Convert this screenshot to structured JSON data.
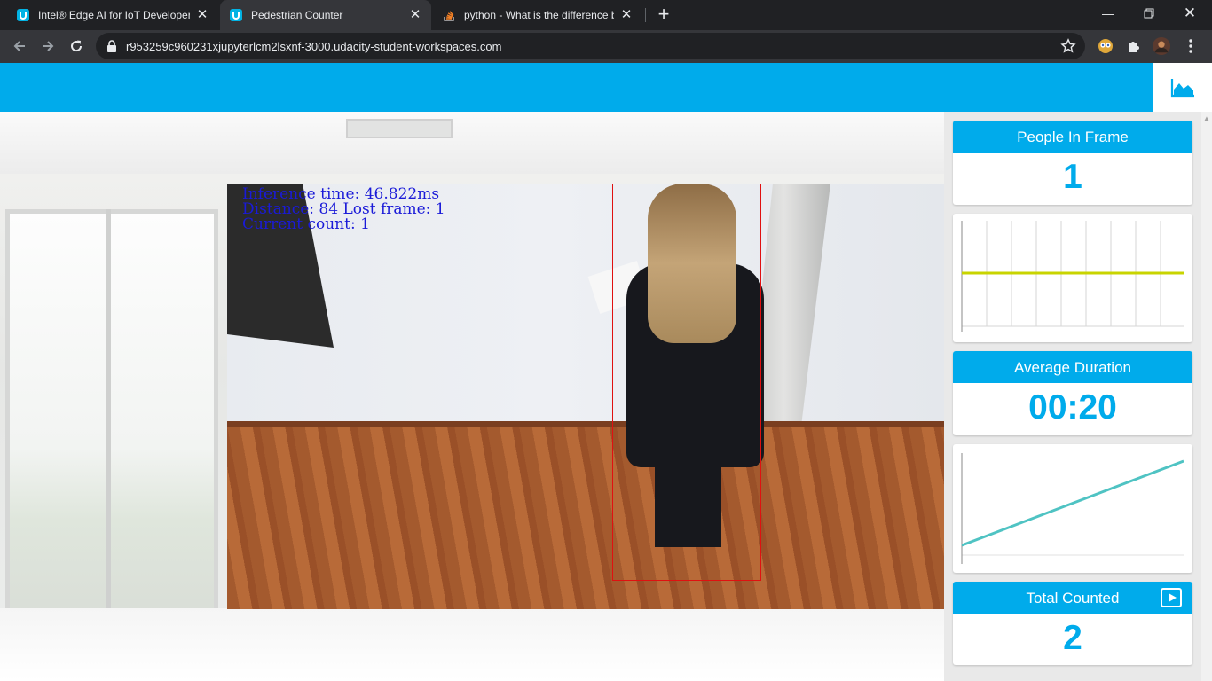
{
  "browser": {
    "tabs": [
      {
        "title": "Intel® Edge AI for IoT Developers",
        "favicon": "udacity-icon",
        "active": false
      },
      {
        "title": "Pedestrian Counter",
        "favicon": "udacity-icon",
        "active": true
      },
      {
        "title": "python - What is the difference b",
        "favicon": "stackoverflow-icon",
        "active": false
      }
    ],
    "url": "r953259c960231xjupyterlcm2lsxnf-3000.udacity-student-workspaces.com"
  },
  "video_overlay": {
    "inference": "Inference time: 46.822ms",
    "distance": "Distance: 84 Lost frame: 1",
    "count": "Current count: 1"
  },
  "stats": {
    "people_in_frame": {
      "label": "People In Frame",
      "value": "1"
    },
    "average_duration": {
      "label": "Average Duration",
      "value": "00:20"
    },
    "total_counted": {
      "label": "Total Counted",
      "value": "2"
    }
  },
  "colors": {
    "accent": "#00abeb",
    "people_series": "#c8d400",
    "duration_series": "#4fc3c3",
    "bbox": "#e01010",
    "overlay_text": "#1a1ad8"
  },
  "icons": {
    "chart_toggle": "area-chart-icon",
    "total_counted_action": "play-icon"
  }
}
